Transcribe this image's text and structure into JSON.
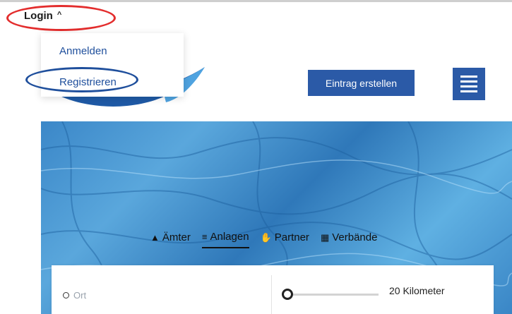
{
  "header": {
    "login_label": "Login",
    "login_caret": "^",
    "dropdown": {
      "items": [
        {
          "label": "Anmelden"
        },
        {
          "label": "Registrieren"
        }
      ]
    },
    "create_button": "Eintrag erstellen",
    "menu_icon": "hamburger-menu-icon"
  },
  "annotations": {
    "login_highlight_color": "#e32d2d",
    "register_highlight_color": "#1f4f9c"
  },
  "tabs": [
    {
      "icon": "stamp-icon",
      "label": "Ämter",
      "active": false
    },
    {
      "icon": "pool-icon",
      "label": "Anlagen",
      "active": true
    },
    {
      "icon": "handshake-icon",
      "label": "Partner",
      "active": false
    },
    {
      "icon": "building-icon",
      "label": "Verbände",
      "active": false
    }
  ],
  "search": {
    "location_placeholder": "Ort",
    "radius_label": "20 Kilometer"
  },
  "colors": {
    "brand_blue": "#2b5aa7",
    "link_blue": "#1f4f9c"
  }
}
